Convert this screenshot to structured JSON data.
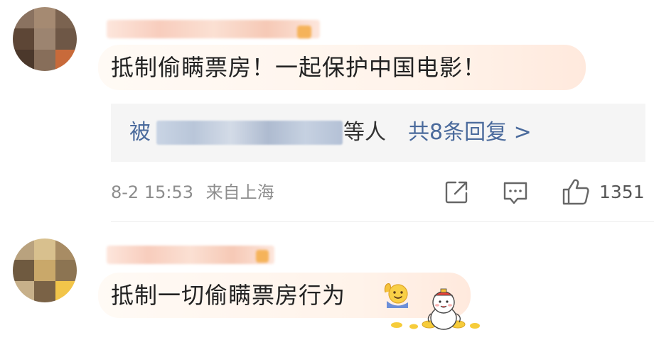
{
  "comments": [
    {
      "text": "抵制偷瞒票房！一起保护中国电影！",
      "reply_summary": {
        "prefix": "被",
        "suffix": "等人",
        "link": "共8条回复 >"
      },
      "meta": {
        "time": "8-2 15:53",
        "location": "来自上海"
      },
      "likes": "1351",
      "icons": {
        "share": "share-icon",
        "comment": "comment-icon",
        "like": "thumbs-up-icon"
      }
    },
    {
      "text": "抵制一切偷瞒票房行为",
      "icons": {
        "emoji": "wave-emoji-icon",
        "sticker": "fortune-doll-sticker-icon"
      }
    }
  ],
  "colors": {
    "link_blue": "#4a6a9c",
    "meta_gray": "#8d8d8d",
    "bubble_peach": "#fff3ea",
    "reply_box_bg": "#f5f5f5"
  }
}
